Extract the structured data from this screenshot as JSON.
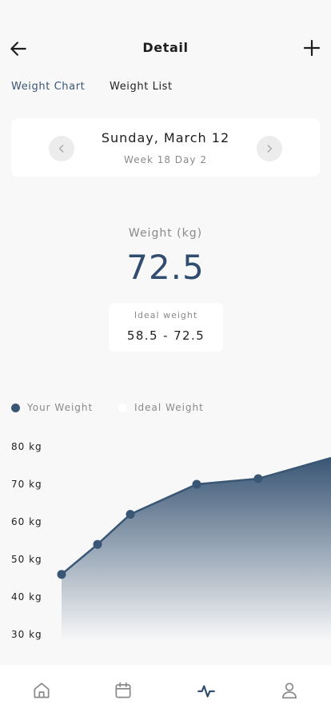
{
  "header": {
    "title": "Detail",
    "back_icon": "arrow-left-icon",
    "add_icon": "plus-icon"
  },
  "tabs": [
    {
      "label": "Weight Chart",
      "active": true
    },
    {
      "label": "Weight List",
      "active": false
    }
  ],
  "date_card": {
    "date": "Sunday, March 12",
    "week": "Week 18 Day 2",
    "prev_icon": "chevron-left-icon",
    "next_icon": "chevron-right-icon"
  },
  "weight": {
    "label": "Weight (kg)",
    "value": "72.5"
  },
  "ideal": {
    "label": "Ideal weight",
    "range": "58.5 - 72.5"
  },
  "legend": [
    {
      "label": "Your Weight",
      "color": "#3a5675"
    },
    {
      "label": "Ideal Weight",
      "color": "#ffffff"
    }
  ],
  "colors": {
    "accent": "#3a5675",
    "accent_dark": "#304c6e",
    "background": "#f8f8f8",
    "card": "#ffffff"
  },
  "chart_data": {
    "type": "area",
    "x": [
      1,
      2,
      3,
      4,
      5,
      6
    ],
    "series": [
      {
        "name": "Your Weight",
        "values": [
          46,
          54,
          62,
          70,
          71.5,
          77
        ]
      }
    ],
    "y_ticks": [
      "80 kg",
      "70 kg",
      "60 kg",
      "50 kg",
      "40 kg",
      "30 kg"
    ],
    "y_tick_values": [
      80,
      70,
      60,
      50,
      40,
      30
    ],
    "ylim": [
      30,
      80
    ],
    "grid": false,
    "legend_position": "top-left"
  },
  "bottom_nav": [
    {
      "icon": "home-icon",
      "active": false
    },
    {
      "icon": "calendar-icon",
      "active": false
    },
    {
      "icon": "activity-icon",
      "active": true
    },
    {
      "icon": "user-icon",
      "active": false
    }
  ]
}
